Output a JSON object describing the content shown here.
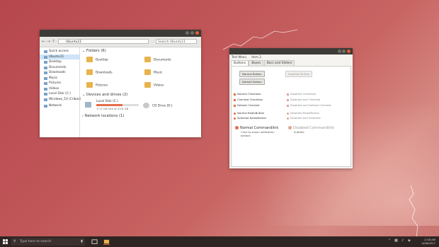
{
  "explorer": {
    "address": "Ubuntu11",
    "search_placeholder": "Search Ubuntu11",
    "sidebar": [
      {
        "label": "Quick access"
      },
      {
        "label": "Ubuntu11"
      },
      {
        "label": "Desktop"
      },
      {
        "label": "Documents"
      },
      {
        "label": "Downloads"
      },
      {
        "label": "Music"
      },
      {
        "label": "Pictures"
      },
      {
        "label": "Videos"
      },
      {
        "label": "Local Disk (C:)"
      },
      {
        "label": "Windows_10 (Cribos)"
      },
      {
        "label": "Network"
      }
    ],
    "folders_header": "Folders (6)",
    "folders": [
      {
        "label": "Desktop"
      },
      {
        "label": "Documents"
      },
      {
        "label": "Downloads"
      },
      {
        "label": "Music"
      },
      {
        "label": "Pictures"
      },
      {
        "label": "Videos"
      }
    ],
    "devices_header": "Devices and drives (2)",
    "drive_c": {
      "label": "Local Disk (C:)",
      "free": "17.0 GB free of 43.8 GB",
      "used_fraction": 0.61
    },
    "drive_d": {
      "label": "CD Drive (D:)"
    },
    "network_header": "Network locations (1)"
  },
  "theme": {
    "menu": [
      "Test Menu",
      "Item 2"
    ],
    "tabs": [
      "Buttons",
      "Boxes",
      "Bars and Sliders"
    ],
    "normal_button": "Normal Button",
    "default_button": "Default Button",
    "disabled_button": "Disabled Button",
    "checkboxes": [
      "Normal Checkbox",
      "Checked Checkbox",
      "Default Checked"
    ],
    "disabled_checkboxes": [
      "Disabled Checkbox",
      "Disabled and Checked",
      "Disabled and Default Checked"
    ],
    "radios": [
      "Normal RadioButton",
      "Selected RadioButton"
    ],
    "disabled_radios": [
      "Disabled RadioButton",
      "Disabled and Selected"
    ],
    "cmd_normal": "Normal Commandlink",
    "cmd_normal_note": "Click to show notification balloon",
    "cmd_disabled": "Disabled Commandlink",
    "cmd_disabled_note": "Subtitle"
  },
  "taskbar": {
    "search_placeholder": "Type here to search",
    "time": "2:18 AM",
    "date": "4/26/2017"
  },
  "colors": {
    "accent": "#e56d49",
    "titlebar": "#3c3b37"
  }
}
